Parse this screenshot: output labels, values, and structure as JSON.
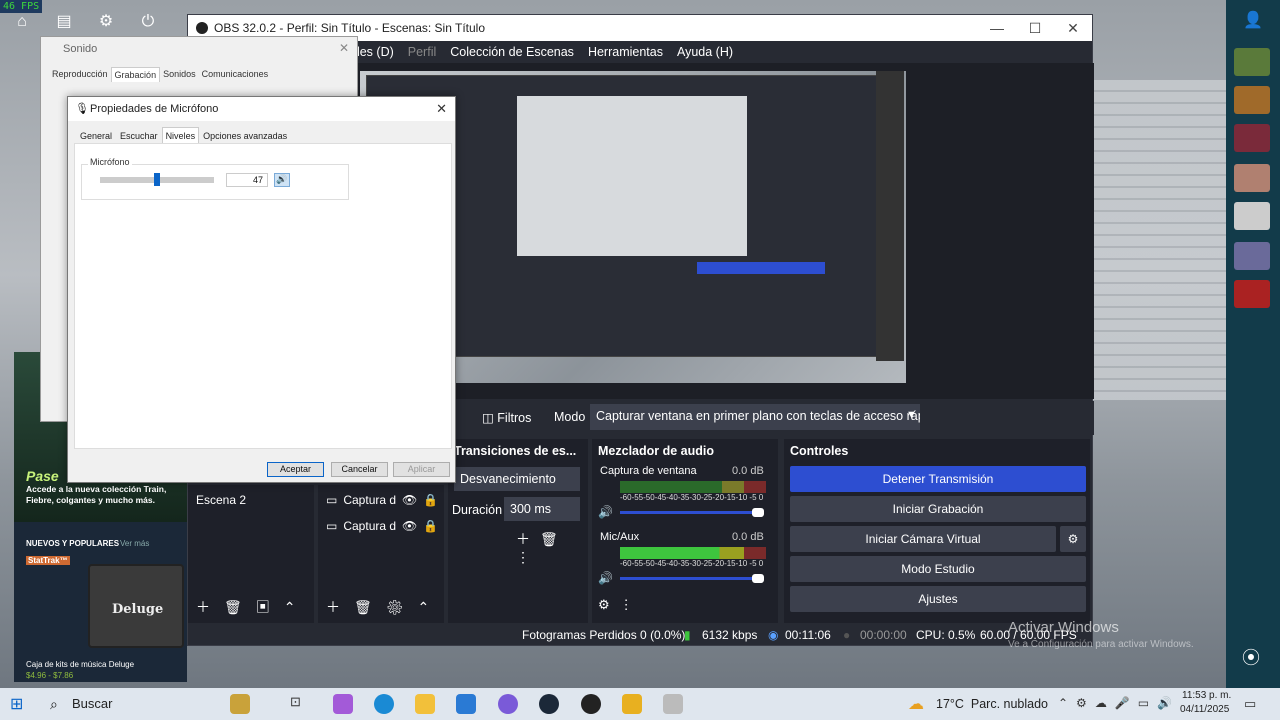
{
  "fps_badge": "46 FPS",
  "obs": {
    "title": "OBS 32.0.2 - Perfil: Sin Título - Escenas: Sin Título",
    "menu": [
      "eles (D)",
      "Perfil",
      "Colección de Escenas",
      "Herramientas",
      "Ayuda (H)"
    ],
    "filters_label": "Filtros",
    "mode_label": "Modo",
    "mode_value": "Capturar ventana en primer plano con teclas de acceso rápi",
    "scenes": {
      "item": "Escena 2"
    },
    "sources": {
      "items": [
        "Captura d",
        "Captura d"
      ]
    },
    "transitions": {
      "title": "Transiciones de es...",
      "type": "Desvanecimiento",
      "duration_label": "Duración",
      "duration_value": "300 ms"
    },
    "mixer": {
      "title": "Mezclador de audio",
      "channels": [
        {
          "name": "Captura de ventana",
          "db": "0.0 dB"
        },
        {
          "name": "Mic/Aux",
          "db": "0.0 dB"
        }
      ],
      "scale": "-60-55-50-45-40-35-30-25-20-15-10 -5  0"
    },
    "controls": {
      "title": "Controles",
      "stop_stream": "Detener Transmisión",
      "start_recording": "Iniciar Grabación",
      "start_virtualcam": "Iniciar Cámara Virtual",
      "studio_mode": "Modo Estudio",
      "settings": "Ajustes"
    },
    "status": {
      "dropped": "Fotogramas Perdidos 0 (0.0%)",
      "bitrate": "6132 kbps",
      "stream_time": "00:11:06",
      "rec_time": "00:00:00",
      "cpu": "CPU: 0.5%",
      "fps": "60.00 / 60.00 FPS"
    }
  },
  "sound_dialog": {
    "title": "Sonido",
    "tabs": [
      "Reproducción",
      "Grabación",
      "Sonidos",
      "Comunicaciones"
    ]
  },
  "mic_dialog": {
    "title": "Propiedades de Micrófono",
    "tabs": [
      "General",
      "Escuchar",
      "Niveles",
      "Opciones avanzadas"
    ],
    "group_label": "Micrófono",
    "level_value": "47",
    "level_fraction": 0.47,
    "ok": "Aceptar",
    "cancel": "Cancelar",
    "apply": "Aplicar"
  },
  "store_ad": {
    "pass_title": "Pase",
    "pass_text": "Accede a la nueva colección Train, Fiebre, colgantes y mucho más.",
    "new_popular": "NUEVOS Y POPULARES",
    "see_more": "Ver más",
    "stattrak": "StatTrak™",
    "item_name": "Caja de kits de música Deluge",
    "price": "$4.96 - $7.86",
    "box_label": "Deluge"
  },
  "watermark": {
    "line1": "Activar Windows",
    "line2": "Ve a Configuración para activar Windows."
  },
  "taskbar": {
    "search": "Buscar",
    "weather": "17°C  Parc. nublado",
    "time": "11:53 p. m.",
    "date": "04/11/2025"
  },
  "colors": {
    "accent_blue": "#2d4ed1",
    "obs_bg": "#272a33",
    "meter_green": "#3ec53e"
  }
}
